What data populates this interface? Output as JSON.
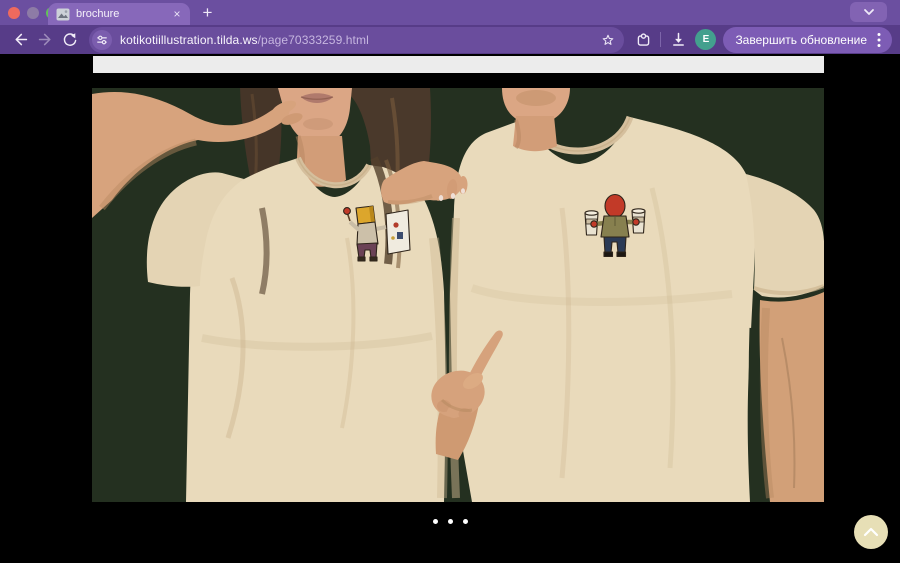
{
  "browser": {
    "tab": {
      "title": "brochure",
      "close_glyph": "×"
    },
    "new_tab_glyph": "+",
    "address": {
      "domain": "kotikotiillustration.tilda.ws",
      "path": "/page70333259.html"
    },
    "profile_initial": "E",
    "update_button_label": "Завершить обновление",
    "colors": {
      "frame": "#6b4fa0",
      "toolbar": "#573c88",
      "active_tab": "#8768ba",
      "update_pill": "#7d5cb5",
      "avatar": "#43a08e",
      "traffic_red": "#ee6a5e",
      "traffic_gray": "#8d7ba6",
      "traffic_green": "#62c356"
    }
  },
  "page": {
    "background": "#000000",
    "previous_slide_edge_color": "#ececec",
    "photo": {
      "background": "#243020",
      "tshirt_color": "#e9dabb",
      "left_print": "artist-painting-at-easel",
      "right_print": "character-holding-two-coffee-cups"
    },
    "carousel": {
      "dot_count": 3
    },
    "scroll_top": {
      "color": "#e7dfb6"
    }
  }
}
